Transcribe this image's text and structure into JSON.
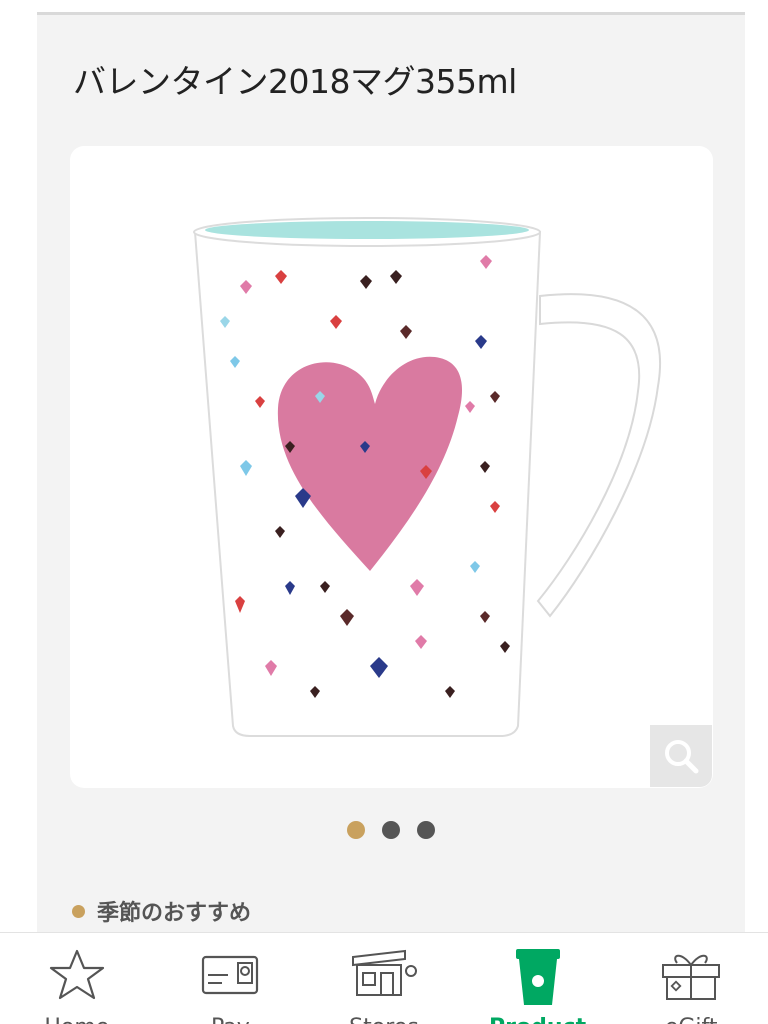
{
  "product": {
    "title": "バレンタイン2018マグ355ml",
    "image_alt": "Valentine mug with pink heart"
  },
  "carousel": {
    "count": 3,
    "active_index": 0
  },
  "section": {
    "label": "季節のおすすめ"
  },
  "tabs": [
    {
      "label": "Home",
      "icon": "star-icon",
      "active": false
    },
    {
      "label": "Pay",
      "icon": "card-icon",
      "active": false
    },
    {
      "label": "Stores",
      "icon": "store-icon",
      "active": false
    },
    {
      "label": "Product",
      "icon": "cup-icon",
      "active": true
    },
    {
      "label": "eGift",
      "icon": "gift-icon",
      "active": false
    }
  ],
  "colors": {
    "accent_gold": "#c9a15e",
    "active_green": "#00a862",
    "heart_pink": "#d97aa0",
    "mug_inner": "#a9e3df"
  }
}
